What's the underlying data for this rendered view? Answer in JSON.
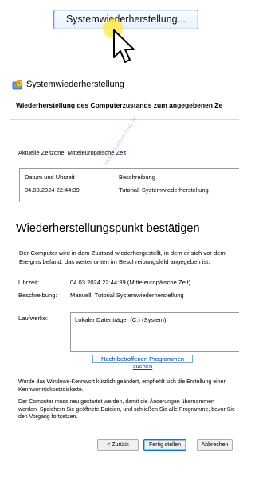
{
  "top_button": {
    "label": "Systemwiederherstellung..."
  },
  "dialog": {
    "title": "Systemwiederherstellung",
    "subtitle": "Wiederherstellung des Computerzustands zum angegebenen Ze",
    "timezone": "Aktuelle Zeitzone: Mitteleuropäische Zeit",
    "table": {
      "headers": [
        "Datum und Uhrzeit",
        "Beschreibung"
      ],
      "rows": [
        [
          "04.03.2024 22:44:39",
          "Tutorial: Systemwiederherstellung"
        ]
      ]
    },
    "confirm_heading": "Wiederherstellungspunkt bestätigen",
    "description": "Der Computer wird in dem Zustand wiederhergestellt, in dem er sich vor dem Ereignis befand, das weiter unten im Beschreibungsfeld angegeben ist.",
    "fields": {
      "time_label": "Uhrzeit:",
      "time_value": "04.03.2024 22:44:39 (Mitteleuropäische Zeit)",
      "desc_label": "Beschreibung:",
      "desc_value": "Manuell: Tutorial Systemwiederherstellung",
      "drives_label": "Laufwerke:",
      "drives_value": "Lokaler Datenträger (C:) (System)"
    },
    "scan_link": "Nach betroffenen Programmen suchen",
    "note1": "Wurde das Windows-Kennwort kürzlich geändert, empfiehlt sich die Erstellung einer Kennwortrücksetzdiskette.",
    "note2": "Der Computer muss neu gestartet werden, damit die Änderungen übernommen werden. Speichern Sie geöffnete Dateien, und schließen Sie alle Programme, bevor Sie den Vorgang fortsetzen.",
    "buttons": {
      "back": "< Zurück",
      "finish": "Fertig stellen",
      "cancel": "Abbrechen"
    }
  },
  "watermark": "www.Windows-FAQ.de"
}
